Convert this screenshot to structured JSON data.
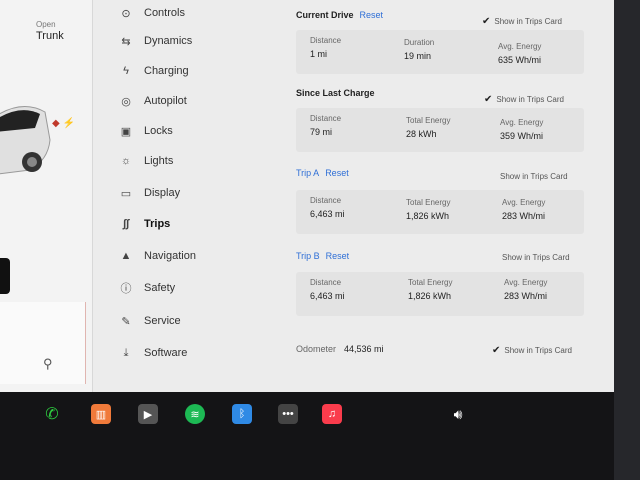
{
  "left_panel": {
    "open_label": "Open",
    "trunk_label": "Trunk"
  },
  "nav": {
    "items": [
      {
        "label": "Controls",
        "icon": "toggle-icon"
      },
      {
        "label": "Dynamics",
        "icon": "car-dynamics-icon"
      },
      {
        "label": "Charging",
        "icon": "bolt-icon"
      },
      {
        "label": "Autopilot",
        "icon": "steering-wheel-icon"
      },
      {
        "label": "Locks",
        "icon": "lock-icon"
      },
      {
        "label": "Lights",
        "icon": "sun-icon"
      },
      {
        "label": "Display",
        "icon": "display-icon"
      },
      {
        "label": "Trips",
        "icon": "trips-icon"
      },
      {
        "label": "Navigation",
        "icon": "navigation-arrow-icon"
      },
      {
        "label": "Safety",
        "icon": "safety-icon"
      },
      {
        "label": "Service",
        "icon": "wrench-icon"
      },
      {
        "label": "Software",
        "icon": "download-icon"
      }
    ]
  },
  "trips": {
    "current_drive": {
      "title": "Current Drive",
      "reset": "Reset",
      "show_card": "Show in Trips Card",
      "distance_label": "Distance",
      "distance": "1 mi",
      "duration_label": "Duration",
      "duration": "19 min",
      "avg_energy_label": "Avg. Energy",
      "avg_energy": "635 Wh/mi"
    },
    "since_last_charge": {
      "title": "Since Last Charge",
      "show_card": "Show in Trips Card",
      "distance_label": "Distance",
      "distance": "79 mi",
      "total_energy_label": "Total Energy",
      "total_energy": "28 kWh",
      "avg_energy_label": "Avg. Energy",
      "avg_energy": "359 Wh/mi"
    },
    "trip_a": {
      "title": "Trip A",
      "reset": "Reset",
      "show_card": "Show in Trips Card",
      "distance_label": "Distance",
      "distance": "6,463 mi",
      "total_energy_label": "Total Energy",
      "total_energy": "1,826 kWh",
      "avg_energy_label": "Avg. Energy",
      "avg_energy": "283 Wh/mi"
    },
    "trip_b": {
      "title": "Trip B",
      "reset": "Reset",
      "show_card": "Show in Trips Card",
      "distance_label": "Distance",
      "distance": "6,463 mi",
      "total_energy_label": "Total Energy",
      "total_energy": "1,826 kWh",
      "avg_energy_label": "Avg. Energy",
      "avg_energy": "283 Wh/mi"
    },
    "odometer_label": "Odometer",
    "odometer_value": "44,536 mi"
  },
  "dock": {
    "icons": [
      "phone-icon",
      "music-equalizer-icon",
      "media-player-icon",
      "spotify-icon",
      "bluetooth-icon",
      "more-icon",
      "apple-music-icon",
      "volume-icon"
    ]
  },
  "colors": {
    "accent_blue": "#2f6fd6",
    "phone_green": "#2ecc40",
    "spotify_green": "#1db954",
    "apple_music_red": "#fa3c4c"
  }
}
